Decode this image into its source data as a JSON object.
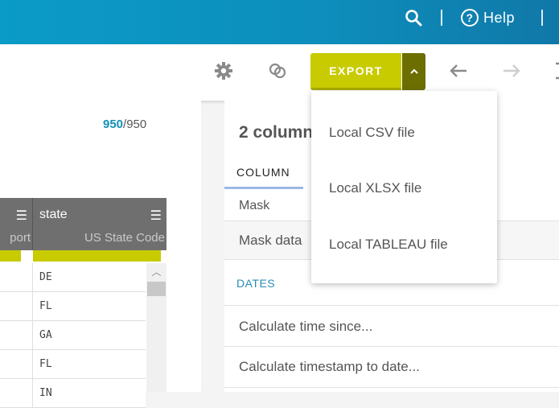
{
  "header": {
    "help_label": "Help"
  },
  "toolbar": {
    "export_label": "EXPORT"
  },
  "dataset": {
    "rows_shown": "950",
    "rows_total": "/950"
  },
  "grid": {
    "left_column": {
      "type_partial": "port"
    },
    "state_column": {
      "name": "state",
      "type": "US State Code"
    },
    "state_values": [
      "DE",
      "FL",
      "GA",
      "FL",
      "IN"
    ]
  },
  "side_panel": {
    "title": "2 column",
    "tab_label": "COLUMN",
    "rows": [
      "Mask",
      "Mask data"
    ],
    "section_label": "DATES",
    "date_actions": [
      "Calculate time since...",
      "Calculate timestamp to date..."
    ]
  },
  "export_menu": {
    "items": [
      "Local CSV file",
      "Local XLSX file",
      "Local TABLEAU file"
    ]
  },
  "colors": {
    "accent": "#c8cb00",
    "header_bg": "#0b9bc7",
    "highlight_number": "#1292b8"
  }
}
